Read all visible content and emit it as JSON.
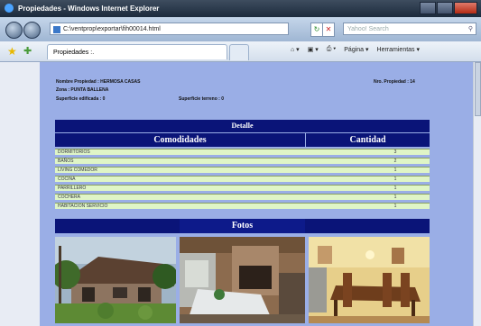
{
  "window": {
    "title": "Propiedades - Windows Internet Explorer"
  },
  "address": {
    "url": "C:\\ventprop\\exportar\\fih00014.html",
    "search_placeholder": "Yahoo! Search"
  },
  "tab": {
    "label": "Propiedades :."
  },
  "commands": {
    "page": "Página",
    "tools": "Herramientas"
  },
  "info": {
    "name_label": "Nombre Propiedad : HERMOSA CASAS",
    "zone_label": "Zona : PUNTA BALLENA",
    "built_label": "Superficie edificada : 0",
    "land_label": "Superficie terreno : 0",
    "nro_label": "Nro. Propiedad : 14"
  },
  "detail": {
    "header": "Detalle",
    "col_amenities": "Comodidades",
    "col_quantity": "Cantidad",
    "rows": [
      {
        "name": "DORMITORIOS",
        "qty": "3"
      },
      {
        "name": "BAÑOS",
        "qty": "2"
      },
      {
        "name": "LIVING COMEDOR",
        "qty": "1"
      },
      {
        "name": "COCINA",
        "qty": "1"
      },
      {
        "name": "PARRILLERO",
        "qty": "1"
      },
      {
        "name": "COCHERA",
        "qty": "1"
      },
      {
        "name": "HABITACION SERVICIO",
        "qty": "1"
      }
    ],
    "photos_header": "Fotos"
  },
  "colors": {
    "band": "#0a1478",
    "page_bg": "#9aaee6",
    "row_bg": "#dff5c6"
  }
}
